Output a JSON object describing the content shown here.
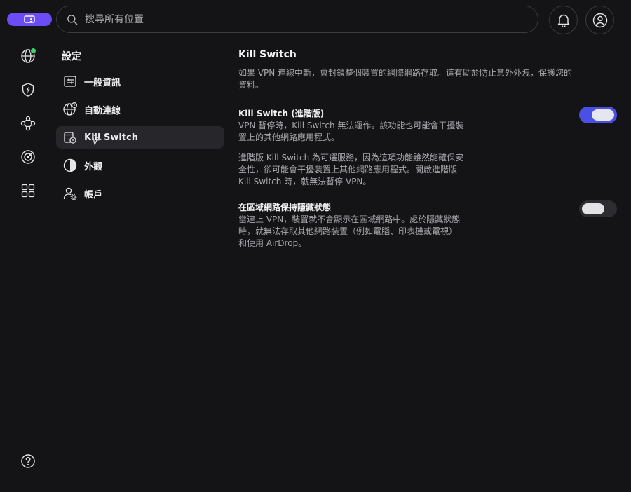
{
  "search": {
    "placeholder": "搜尋所有位置"
  },
  "sidebar": {
    "items": [
      {
        "name": "globe-icon",
        "status": "connected"
      },
      {
        "name": "shield-bolt-icon"
      },
      {
        "name": "nodes-icon"
      },
      {
        "name": "target-icon"
      },
      {
        "name": "grid-icon"
      },
      {
        "name": "help-icon"
      }
    ]
  },
  "settings_menu": {
    "title": "設定",
    "items": [
      {
        "label": "一般資訊",
        "icon": "sliders-icon"
      },
      {
        "label": "自動連線",
        "icon": "globe-auto-icon"
      },
      {
        "label": "Kill Switch",
        "icon": "kill-switch-icon",
        "active": true
      },
      {
        "label": "外觀",
        "icon": "appearance-icon"
      },
      {
        "label": "帳戶",
        "icon": "account-icon"
      }
    ]
  },
  "content": {
    "title": "Kill Switch",
    "intro": "如果 VPN 連線中斷，會封鎖整個裝置的網際網路存取。這有助於防止意外外洩，保護您的資料。",
    "advanced": {
      "title": "Kill Switch (進階版)",
      "desc1": "VPN 暫停時，Kill Switch 無法運作。該功能也可能會干擾裝置上的其他網路應用程式。",
      "desc2": "進階版 Kill Switch 為可選服務，因為這項功能雖然能確保安全性，卻可能會干擾裝置上其他網路應用程式。開啟進階版 Kill Switch 時，就無法暫停 VPN。",
      "enabled": true
    },
    "lan": {
      "title": "在區域網路保持隱藏狀態",
      "desc": "當連上 VPN，裝置就不會顯示在區域網路中。處於隱藏狀態時，就無法存取其他網路裝置（例如電腦、印表機或電視）和使用 AirDrop。",
      "enabled": false
    }
  },
  "colors": {
    "accent": "#6b4cf6",
    "toggle_on": "#4a4fe6",
    "status_green": "#3dd16b",
    "background": "#141416"
  }
}
